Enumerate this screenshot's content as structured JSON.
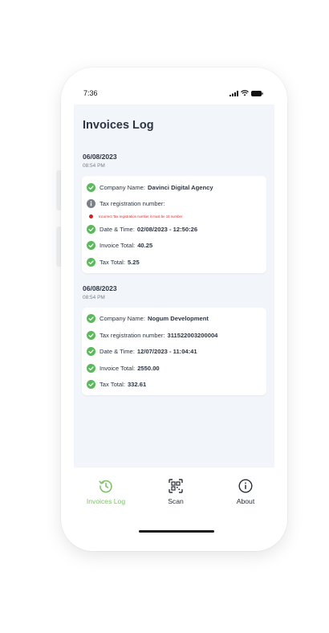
{
  "status_bar": {
    "time": "7:36"
  },
  "page": {
    "title": "Invoices Log"
  },
  "invoices": [
    {
      "date": "06/08/2023",
      "time": "08:54 PM",
      "company": {
        "label": "Company Name:",
        "value": "Davinci Digital Agency"
      },
      "tax_reg": {
        "label": "Tax registration number:",
        "value": ""
      },
      "error": "Incorrect Tax registration number it must be 15 number",
      "datetime": {
        "label": "Date & Time:",
        "value": "02/08/2023 - 12:50:26"
      },
      "invoice_total": {
        "label": "Invoice Total:",
        "value": "40.25"
      },
      "tax_total": {
        "label": "Tax Total:",
        "value": "5.25"
      }
    },
    {
      "date": "06/08/2023",
      "time": "08:54 PM",
      "company": {
        "label": "Company Name:",
        "value": "Nogum Development"
      },
      "tax_reg": {
        "label": "Tax registration number:",
        "value": "311522003200004"
      },
      "datetime": {
        "label": "Date & Time:",
        "value": "12/07/2023 - 11:04:41"
      },
      "invoice_total": {
        "label": "Invoice Total:",
        "value": "2550.00"
      },
      "tax_total": {
        "label": "Tax Total:",
        "value": "332.61"
      }
    }
  ],
  "tabs": [
    {
      "label": "Invoices Log",
      "icon": "history-icon",
      "active": true
    },
    {
      "label": "Scan",
      "icon": "qr-scan-icon",
      "active": false
    },
    {
      "label": "About",
      "icon": "info-icon",
      "active": false
    }
  ],
  "colors": {
    "success": "#5cb85c",
    "accent": "#7ec26a",
    "error": "#d61f1f",
    "info": "#7b7f86",
    "screen_bg": "#f2f5fa"
  }
}
